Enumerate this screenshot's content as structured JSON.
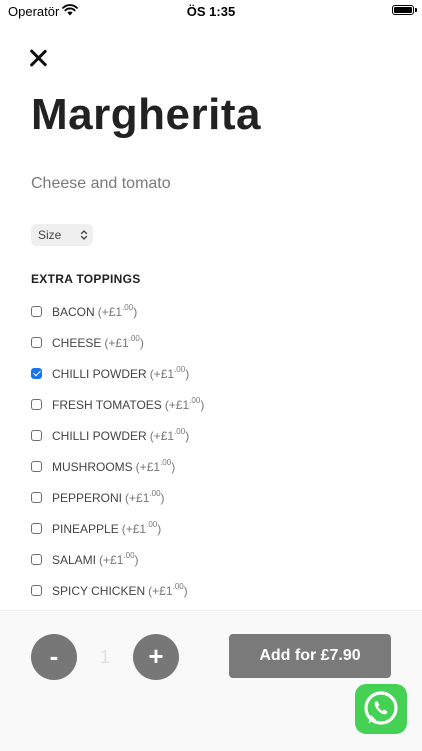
{
  "status_bar": {
    "carrier": "Operatör",
    "time": "ÖS 1:35"
  },
  "product": {
    "title": "Margherita",
    "subtitle": "Cheese and tomato"
  },
  "size_select": {
    "label": "Size",
    "chevron": "⌃⌄"
  },
  "extras": {
    "title": "EXTRA TOPPINGS",
    "price_open": "(+",
    "price_close": ")",
    "currency": "£",
    "items": [
      {
        "name": "BACON",
        "major": "1",
        "minor": ".00",
        "checked": false
      },
      {
        "name": "CHEESE",
        "major": "1",
        "minor": ".00",
        "checked": false
      },
      {
        "name": "CHILLI POWDER",
        "major": "1",
        "minor": ".00",
        "checked": true
      },
      {
        "name": "FRESH TOMATOES",
        "major": "1",
        "minor": ".00",
        "checked": false
      },
      {
        "name": "CHILLI POWDER",
        "major": "1",
        "minor": ".00",
        "checked": false
      },
      {
        "name": "MUSHROOMS",
        "major": "1",
        "minor": ".00",
        "checked": false
      },
      {
        "name": "PEPPERONI",
        "major": "1",
        "minor": ".00",
        "checked": false
      },
      {
        "name": "PINEAPPLE",
        "major": "1",
        "minor": ".00",
        "checked": false
      },
      {
        "name": "SALAMI",
        "major": "1",
        "minor": ".00",
        "checked": false
      },
      {
        "name": "SPICY CHICKEN",
        "major": "1",
        "minor": ".00",
        "checked": false
      }
    ]
  },
  "order_bar": {
    "minus_label": "-",
    "quantity": "1",
    "plus_label": "+",
    "add_label": "Add for £7.90"
  },
  "icons": {
    "close": "close-icon",
    "wifi": "wifi-icon",
    "battery": "battery-icon",
    "whatsapp": "whatsapp-icon"
  },
  "colors": {
    "checkbox_checked": "#1a73e8",
    "button_gray": "#777777",
    "whatsapp_green": "#45d254"
  }
}
